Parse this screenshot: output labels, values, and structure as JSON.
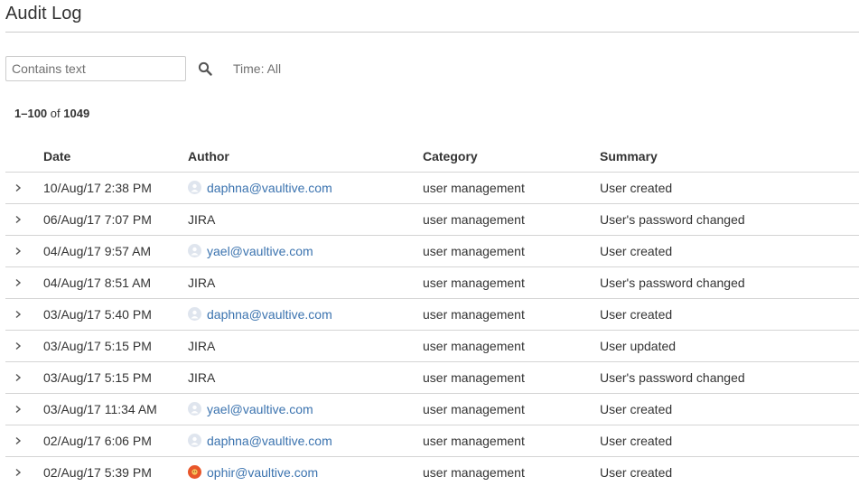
{
  "page": {
    "title": "Audit Log"
  },
  "filters": {
    "search_placeholder": "Contains text",
    "search_value": "",
    "search_icon": "search-icon",
    "time_label": "Time: All"
  },
  "count": {
    "range": "1–100",
    "of": "of",
    "total": "1049"
  },
  "table": {
    "headers": {
      "date": "Date",
      "author": "Author",
      "category": "Category",
      "summary": "Summary"
    },
    "rows": [
      {
        "date": "10/Aug/17 2:38 PM",
        "author": "daphna@vaultive.com",
        "author_type": "user",
        "avatar": "grey",
        "category": "user management",
        "summary": "User created"
      },
      {
        "date": "06/Aug/17 7:07 PM",
        "author": "JIRA",
        "author_type": "system",
        "avatar": "",
        "category": "user management",
        "summary": "User's password changed"
      },
      {
        "date": "04/Aug/17 9:57 AM",
        "author": "yael@vaultive.com",
        "author_type": "user",
        "avatar": "grey",
        "category": "user management",
        "summary": "User created"
      },
      {
        "date": "04/Aug/17 8:51 AM",
        "author": "JIRA",
        "author_type": "system",
        "avatar": "",
        "category": "user management",
        "summary": "User's password changed"
      },
      {
        "date": "03/Aug/17 5:40 PM",
        "author": "daphna@vaultive.com",
        "author_type": "user",
        "avatar": "grey",
        "category": "user management",
        "summary": "User created"
      },
      {
        "date": "03/Aug/17 5:15 PM",
        "author": "JIRA",
        "author_type": "system",
        "avatar": "",
        "category": "user management",
        "summary": "User updated"
      },
      {
        "date": "03/Aug/17 5:15 PM",
        "author": "JIRA",
        "author_type": "system",
        "avatar": "",
        "category": "user management",
        "summary": "User's password changed"
      },
      {
        "date": "03/Aug/17 11:34 AM",
        "author": "yael@vaultive.com",
        "author_type": "user",
        "avatar": "grey",
        "category": "user management",
        "summary": "User created"
      },
      {
        "date": "02/Aug/17 6:06 PM",
        "author": "daphna@vaultive.com",
        "author_type": "user",
        "avatar": "grey",
        "category": "user management",
        "summary": "User created"
      },
      {
        "date": "02/Aug/17 5:39 PM",
        "author": "ophir@vaultive.com",
        "author_type": "user",
        "avatar": "orange",
        "category": "user management",
        "summary": "User created"
      }
    ]
  },
  "colors": {
    "link": "#3b73af",
    "text": "#333333",
    "muted": "#707070",
    "divider": "#d4d4d4",
    "avatar_grey": "#dfe5ee",
    "avatar_orange": "#e8562a"
  }
}
